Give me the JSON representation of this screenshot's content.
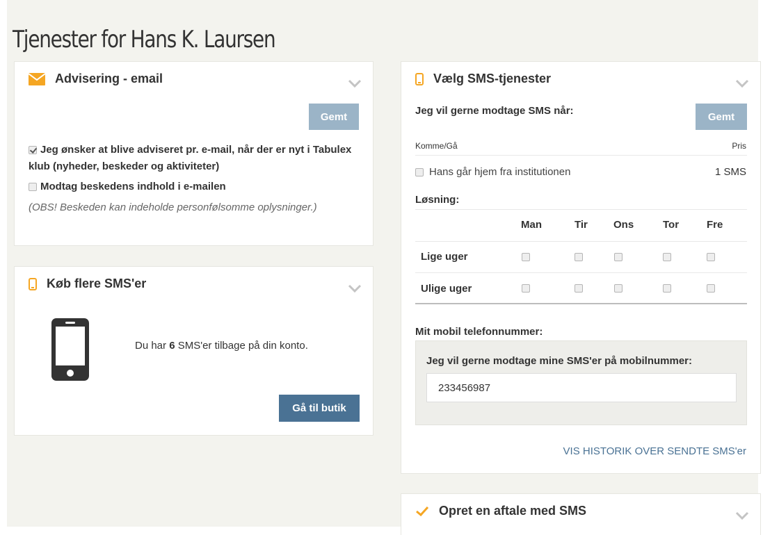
{
  "page": {
    "title": "Tjenester for Hans K. Laursen"
  },
  "email_panel": {
    "title": "Advisering - email",
    "save_label": "Gemt",
    "option1": {
      "label": "Jeg ønsker at blive adviseret pr. e-mail, når der er nyt i Tabulex klub (nyheder, beskeder og aktiviteter)",
      "checked": true
    },
    "option2": {
      "label": "Modtag beskedens indhold i e-mailen",
      "checked": false
    },
    "note": "(OBS! Beskeden kan indeholde personfølsomme oplysninger.)"
  },
  "buy_panel": {
    "title": "Køb flere SMS'er",
    "text_before": "Du har ",
    "count": "6",
    "text_after": " SMS'er tilbage på din konto.",
    "shop_label": "Gå til butik"
  },
  "sms_panel": {
    "title": "Vælg SMS-tjenester",
    "intro": "Jeg vil gerne modtage SMS når:",
    "save_label": "Gemt",
    "col_left": "Komme/Gå",
    "col_right": "Pris",
    "item": {
      "label": "Hans går hjem fra institutionen",
      "price": "1 SMS",
      "checked": false
    },
    "solution_label": "Løsning:",
    "days": [
      "Man",
      "Tir",
      "Ons",
      "Tor",
      "Fre"
    ],
    "rows": [
      "Lige uger",
      "Ulige uger"
    ],
    "phone_section_label": "Mit mobil telefonnummer:",
    "phone_prompt": "Jeg vil gerne modtage mine SMS'er på mobilnummer:",
    "phone_value": "233456987",
    "history_link": "VIS HISTORIK OVER SENDTE SMS'er"
  },
  "agreement_panel": {
    "title": "Opret en aftale med SMS"
  },
  "colors": {
    "accent_orange": "#f5a623",
    "button_saved": "#9bb4c7",
    "button_dark": "#4a7294",
    "link": "#4a7294"
  }
}
